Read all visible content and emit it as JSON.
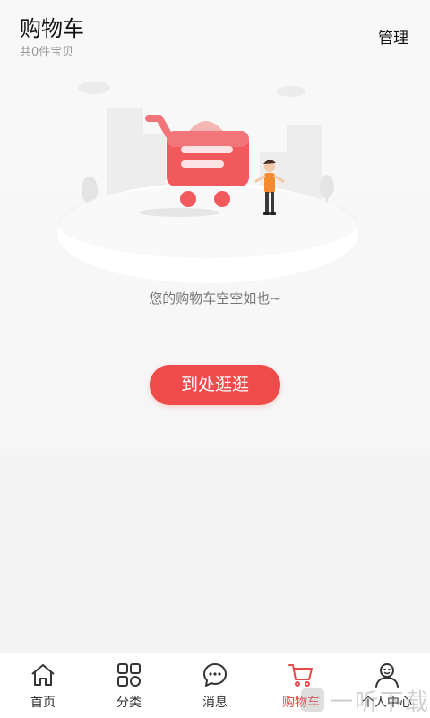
{
  "header": {
    "title": "购物车",
    "subtitle": "共0件宝贝",
    "manage_label": "管理"
  },
  "empty": {
    "message": "您的购物车空空如也~",
    "button_label": "到处逛逛"
  },
  "tabs": [
    {
      "label": "首页",
      "icon": "home-icon",
      "active": false
    },
    {
      "label": "分类",
      "icon": "category-icon",
      "active": false
    },
    {
      "label": "消息",
      "icon": "message-icon",
      "active": false
    },
    {
      "label": "购物车",
      "icon": "cart-icon",
      "active": true
    },
    {
      "label": "个人中心",
      "icon": "profile-icon",
      "active": false
    }
  ],
  "watermark": {
    "text": "一听下载"
  },
  "colors": {
    "accent": "#f04b4b",
    "active_tab": "#e84a4a",
    "text_gray": "#777777"
  }
}
